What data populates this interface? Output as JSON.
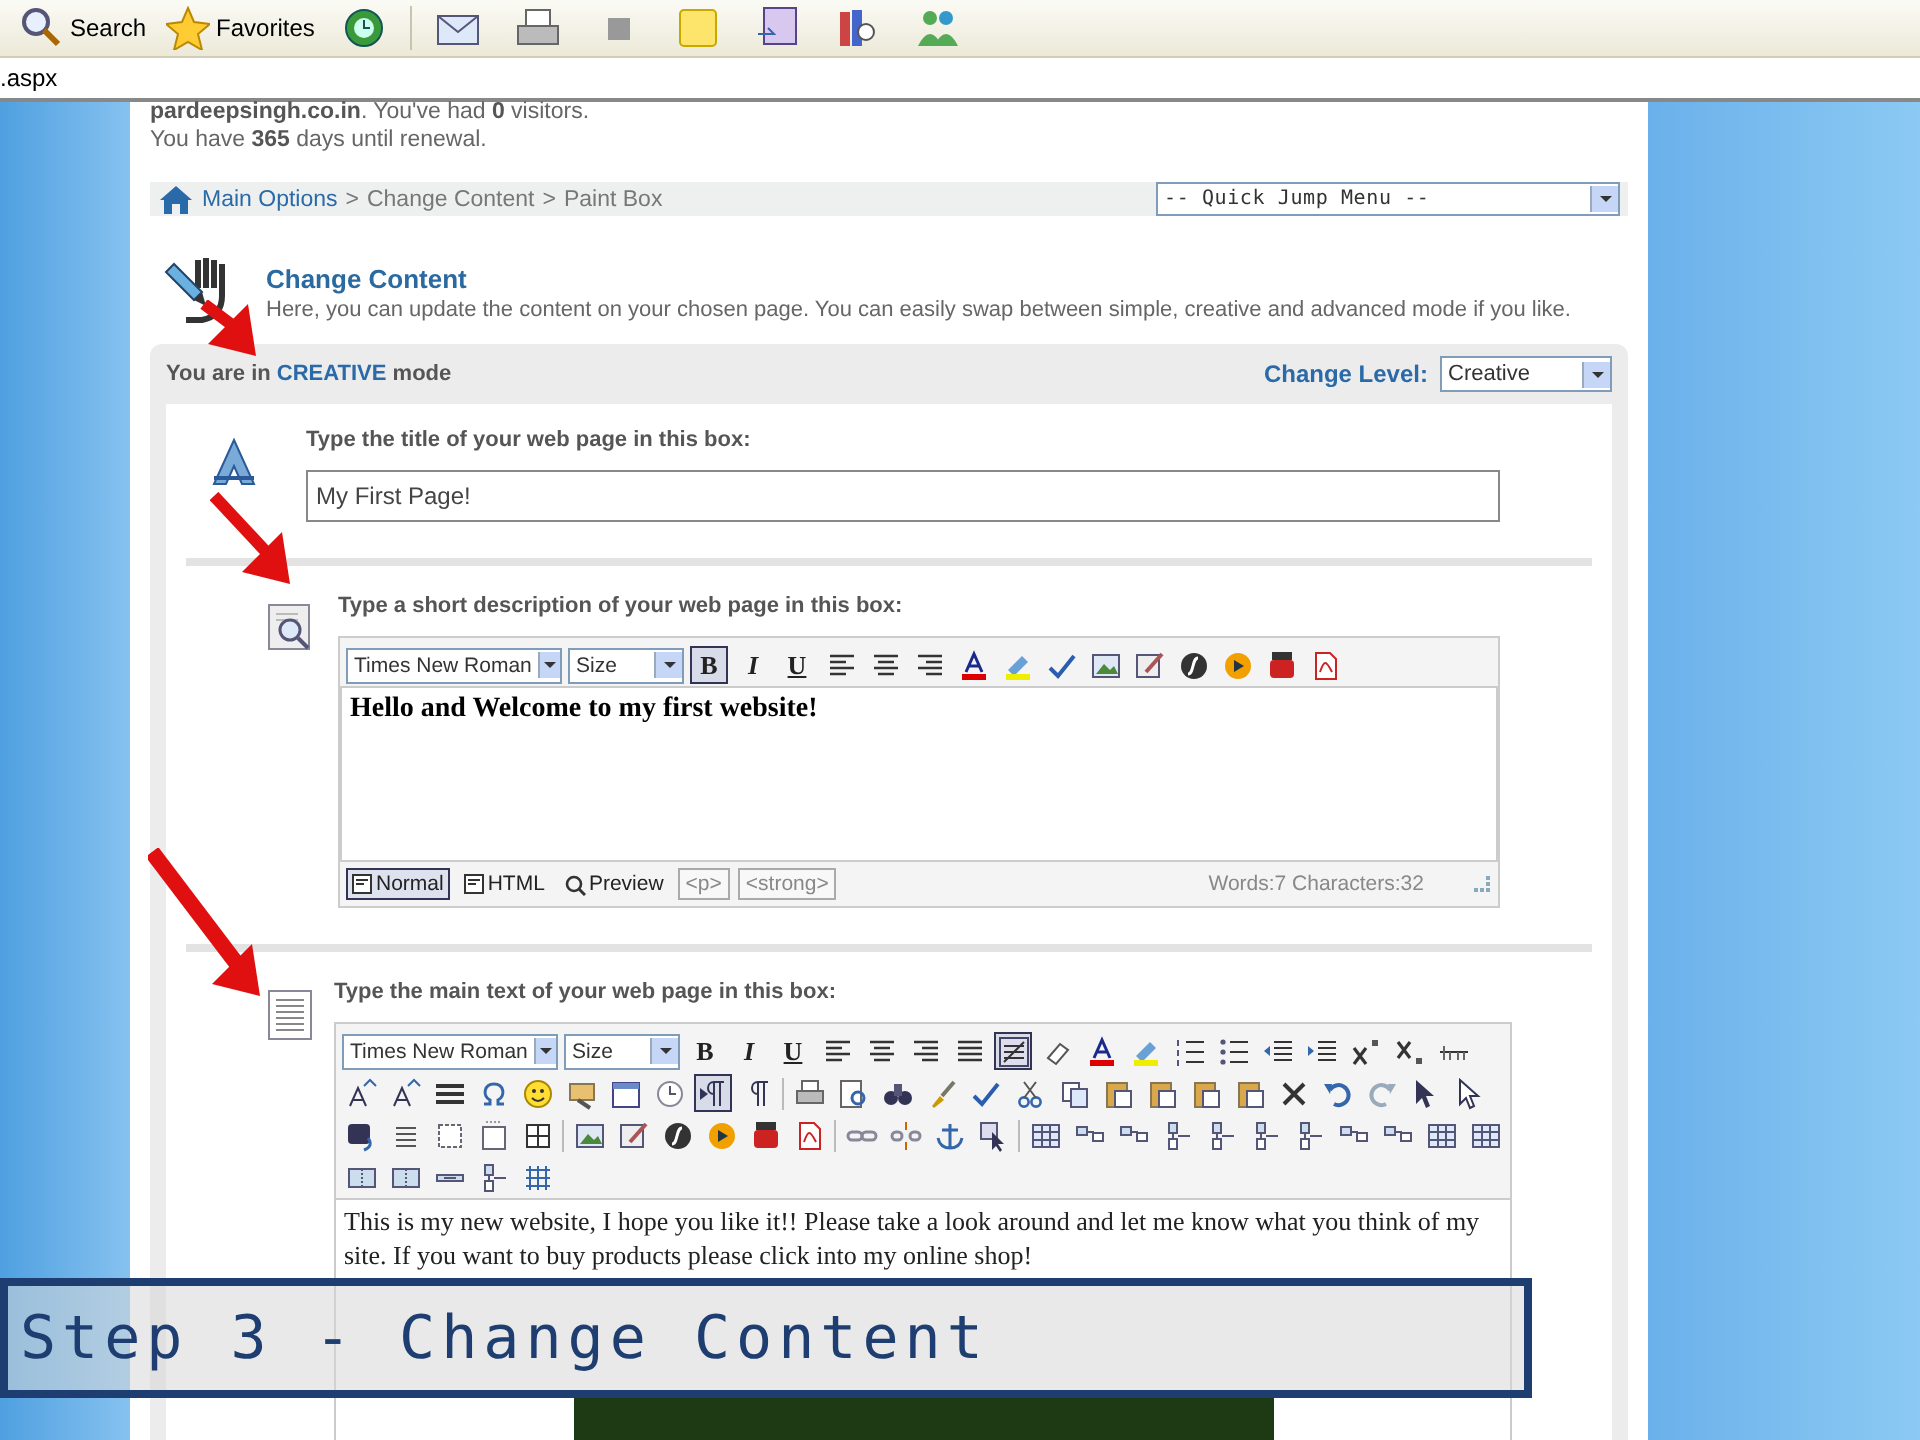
{
  "browser_toolbar": {
    "buttons": [
      {
        "label": "Search"
      },
      {
        "label": "Favorites"
      }
    ]
  },
  "address_bar": {
    "value": ".aspx"
  },
  "account": {
    "line_1": "**pardeepsingh.co.in**. You've had **0** visitors.",
    "line_2": "You have **365** days until renewal."
  },
  "breadcrumb": [
    {
      "kind": "link",
      "text": "Main Options"
    },
    {
      "kind": "sep",
      "text": ">"
    },
    {
      "kind": "text",
      "text": "Change Content"
    },
    {
      "kind": "sep",
      "text": ">"
    },
    {
      "kind": "text",
      "text": "Paint Box"
    }
  ],
  "quick_jump": {
    "value": "-- Quick Jump Menu --"
  },
  "header": {
    "title": "Change Content",
    "description": "Here, you can update the content on your chosen page. You can easily swap between simple, creative and advanced mode if you like."
  },
  "mode_bar": {
    "prefix": "You are in",
    "mode": "CREATIVE",
    "suffix": "mode",
    "level_label": "Change Level:",
    "level_value": "Creative"
  },
  "sections": [
    {
      "kind": "title",
      "prompt": "Type the title of your web page in this box:",
      "value": "My First Page!"
    },
    {
      "kind": "editor",
      "prompt": "Type a short description of your web page in this box:",
      "font": "Times New Roman",
      "size": "Size",
      "format_buttons": [
        {
          "label": "B",
          "selected": true
        },
        {
          "label": "I",
          "selected": false
        },
        {
          "label": "U",
          "selected": false
        }
      ],
      "content": [
        "Hello and Welcome to my first website!"
      ],
      "modes": [
        {
          "label": "Normal",
          "selected": true
        },
        {
          "label": "HTML",
          "selected": false
        },
        {
          "label": "Preview",
          "selected": false
        }
      ],
      "tags": [
        "<p>",
        "<strong>"
      ],
      "stats": "Words:7 Characters:32"
    },
    {
      "kind": "full_editor",
      "prompt": "Type the main text of your web page in this box:",
      "font": "Times New Roman",
      "size": "Size",
      "format_buttons": [
        {
          "label": "B",
          "selected": false
        },
        {
          "label": "I",
          "selected": false
        },
        {
          "label": "U",
          "selected": false
        }
      ],
      "content": [
        "This is my new website, I hope you like it!! Please take a look around and let me know what you think of my site. If you want to buy products please click into my online shop!"
      ]
    }
  ],
  "overlay": {
    "text": "Step 3 - Change Content"
  }
}
